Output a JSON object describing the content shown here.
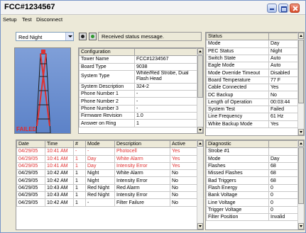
{
  "window": {
    "title": "FCC#1234567"
  },
  "menu": [
    "Setup",
    "Test",
    "Disconnect"
  ],
  "toolbar": {
    "mode_select": "Red Night",
    "status_message": "Received status message."
  },
  "tower": {
    "status_label": "FAILED"
  },
  "configuration": {
    "header": "Configuration",
    "rows": [
      [
        "Tower Name",
        "FCC#1234567"
      ],
      [
        "Board Type",
        "9038"
      ],
      [
        "System Type",
        "White/Red Strobe, Dual Flash Head"
      ],
      [
        "System Description",
        "324-2"
      ],
      [
        "Phone Number 1",
        "-"
      ],
      [
        "Phone Number 2",
        "-"
      ],
      [
        "Phone Number 3",
        "-"
      ],
      [
        "Firmware Revision",
        "1.0"
      ],
      [
        "Answer on Ring",
        "1"
      ]
    ]
  },
  "status": {
    "header": "Status",
    "rows": [
      [
        "Mode",
        "Day"
      ],
      [
        "PEC Status",
        "Night"
      ],
      [
        "Switch State",
        "Auto"
      ],
      [
        "Eagle Mode",
        "Auto"
      ],
      [
        "Mode Override Timeout",
        "Disabled"
      ],
      [
        "Board Temperature",
        "77 F"
      ],
      [
        "Cable Connected",
        "Yes"
      ],
      [
        "DC Backup",
        "No"
      ],
      [
        "Length of Operation",
        "00:03:44"
      ],
      [
        "System Test",
        "Failed"
      ],
      [
        "Line Frequency",
        "61 Hz"
      ],
      [
        "White Backup Mode",
        "Yes"
      ]
    ]
  },
  "events": {
    "columns": [
      "Date",
      "Time",
      "#",
      "Mode",
      "Description",
      "Active"
    ],
    "rows": [
      {
        "cells": [
          "04/29/05",
          "10:41 AM",
          "-",
          "-",
          "Photocell",
          "Yes"
        ],
        "alert": true
      },
      {
        "cells": [
          "04/29/05",
          "10:41 AM",
          "1",
          "Day",
          "White Alarm",
          "Yes"
        ],
        "alert": true
      },
      {
        "cells": [
          "04/29/05",
          "10:41 AM",
          "1",
          "Day",
          "Intensity Error",
          "Yes"
        ],
        "alert": true
      },
      {
        "cells": [
          "04/29/05",
          "10:42 AM",
          "1",
          "Night",
          "White Alarm",
          "No"
        ],
        "alert": false
      },
      {
        "cells": [
          "04/29/05",
          "10:42 AM",
          "1",
          "Night",
          "Intensity Error",
          "No"
        ],
        "alert": false
      },
      {
        "cells": [
          "04/29/05",
          "10:43 AM",
          "1",
          "Red Night",
          "Red Alarm",
          "No"
        ],
        "alert": false
      },
      {
        "cells": [
          "04/29/05",
          "10:43 AM",
          "1",
          "Red Night",
          "Intensity Error",
          "No"
        ],
        "alert": false
      },
      {
        "cells": [
          "04/29/05",
          "10:42 AM",
          "1",
          "-",
          "Filter Failure",
          "No"
        ],
        "alert": false
      }
    ]
  },
  "diagnostic": {
    "header": "Diagnostic",
    "section": "Strobe #1",
    "rows": [
      [
        "Mode",
        "Day"
      ],
      [
        "Flashes",
        "68"
      ],
      [
        "Missed Flashes",
        "68"
      ],
      [
        "Bad Triggers",
        "68"
      ],
      [
        "Flash Energy",
        "0"
      ],
      [
        "Bank Voltage",
        "0"
      ],
      [
        "Line Voltage",
        "0"
      ],
      [
        "Trigger Voltage",
        "0"
      ],
      [
        "Filter Position",
        "Invalid"
      ]
    ]
  },
  "colors": {
    "alert": "#e03030",
    "failed": "#e22a2a",
    "sky": "#6a8fd0"
  }
}
